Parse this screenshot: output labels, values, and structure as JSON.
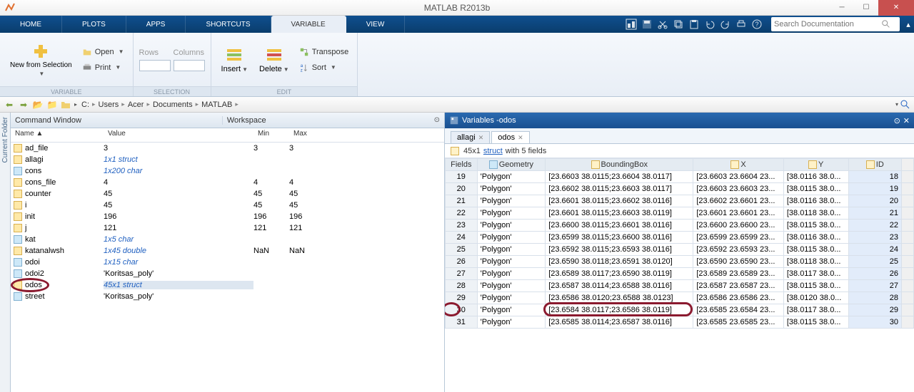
{
  "titlebar": {
    "title": "MATLAB R2013b"
  },
  "tabs": [
    "HOME",
    "PLOTS",
    "APPS",
    "SHORTCUTS",
    "VARIABLE",
    "VIEW"
  ],
  "active_tab": 4,
  "search_placeholder": "Search Documentation",
  "ribbon": {
    "variable": {
      "newfrom": "New from\nSelection",
      "open": "Open",
      "print": "Print",
      "rows": "Rows",
      "columns": "Columns"
    },
    "edit": {
      "insert": "Insert",
      "delete": "Delete",
      "sort": "Sort",
      "transpose": "Transpose"
    },
    "group_labels": [
      "VARIABLE",
      "SELECTION",
      "EDIT"
    ]
  },
  "breadcrumb": [
    "C:",
    "Users",
    "Acer",
    "Documents",
    "MATLAB"
  ],
  "sidebar_label": "Current Folder",
  "panes": {
    "command": "Command Window",
    "workspace": "Workspace",
    "variables_prefix": "Variables - ",
    "variables_name": "odos"
  },
  "ws_headers": [
    "Name ▲",
    "Value",
    "Min",
    "Max"
  ],
  "ws_rows": [
    {
      "icon": "num",
      "name": "ad_file",
      "val": "3",
      "min": "3",
      "max": "3"
    },
    {
      "icon": "num",
      "name": "allagi",
      "val": "1x1 struct",
      "italic": true
    },
    {
      "icon": "abc",
      "name": "cons",
      "val": "1x200 char",
      "italic": true
    },
    {
      "icon": "num",
      "name": "cons_file",
      "val": "4",
      "min": "4",
      "max": "4"
    },
    {
      "icon": "num",
      "name": "counter",
      "val": "45",
      "min": "45",
      "max": "45"
    },
    {
      "icon": "num",
      "name": "i",
      "val": "45",
      "min": "45",
      "max": "45"
    },
    {
      "icon": "num",
      "name": "init",
      "val": "196",
      "min": "196",
      "max": "196"
    },
    {
      "icon": "num",
      "name": "j",
      "val": "121",
      "min": "121",
      "max": "121"
    },
    {
      "icon": "abc",
      "name": "kat",
      "val": "1x5 char",
      "italic": true
    },
    {
      "icon": "num",
      "name": "katanalwsh",
      "val": "1x45 double",
      "italic": true,
      "min": "NaN",
      "max": "NaN"
    },
    {
      "icon": "abc",
      "name": "odoi",
      "val": "1x15 char",
      "italic": true
    },
    {
      "icon": "abc",
      "name": "odoi2",
      "val": "'Koritsas_poly'"
    },
    {
      "icon": "num",
      "name": "odos",
      "val": "45x1 struct",
      "italic": true,
      "selected": true,
      "circled": true
    },
    {
      "icon": "abc",
      "name": "street",
      "val": "'Koritsas_poly'"
    }
  ],
  "var_tabs": [
    {
      "name": "allagi",
      "active": false
    },
    {
      "name": "odos",
      "active": true
    }
  ],
  "var_info": {
    "size": "45x1",
    "type": "struct",
    "suffix": "with 5 fields"
  },
  "var_columns": [
    {
      "key": "Fields",
      "label": "Fields"
    },
    {
      "key": "Geometry",
      "label": "Geometry",
      "icon": "str"
    },
    {
      "key": "BoundingBox",
      "label": "BoundingBox",
      "icon": "num"
    },
    {
      "key": "X",
      "label": "X",
      "icon": "num"
    },
    {
      "key": "Y",
      "label": "Y",
      "icon": "num"
    },
    {
      "key": "ID",
      "label": "ID",
      "icon": "num",
      "blue": true
    }
  ],
  "var_rows": [
    {
      "n": 19,
      "g": "'Polygon'",
      "b": "[23.6603 38.0115;23.6604 38.0117]",
      "x": "[23.6603 23.6604 23...",
      "y": "[38.0116 38.0...",
      "id": 18
    },
    {
      "n": 20,
      "g": "'Polygon'",
      "b": "[23.6602 38.0115;23.6603 38.0117]",
      "x": "[23.6603 23.6603 23...",
      "y": "[38.0115 38.0...",
      "id": 19
    },
    {
      "n": 21,
      "g": "'Polygon'",
      "b": "[23.6601 38.0115;23.6602 38.0116]",
      "x": "[23.6602 23.6601 23...",
      "y": "[38.0116 38.0...",
      "id": 20
    },
    {
      "n": 22,
      "g": "'Polygon'",
      "b": "[23.6601 38.0115;23.6603 38.0119]",
      "x": "[23.6601 23.6601 23...",
      "y": "[38.0118 38.0...",
      "id": 21
    },
    {
      "n": 23,
      "g": "'Polygon'",
      "b": "[23.6600 38.0115;23.6601 38.0116]",
      "x": "[23.6600 23.6600 23...",
      "y": "[38.0115 38.0...",
      "id": 22
    },
    {
      "n": 24,
      "g": "'Polygon'",
      "b": "[23.6599 38.0115;23.6600 38.0116]",
      "x": "[23.6599 23.6599 23...",
      "y": "[38.0116 38.0...",
      "id": 23
    },
    {
      "n": 25,
      "g": "'Polygon'",
      "b": "[23.6592 38.0115;23.6593 38.0116]",
      "x": "[23.6592 23.6593 23...",
      "y": "[38.0115 38.0...",
      "id": 24
    },
    {
      "n": 26,
      "g": "'Polygon'",
      "b": "[23.6590 38.0118;23.6591 38.0120]",
      "x": "[23.6590 23.6590 23...",
      "y": "[38.0118 38.0...",
      "id": 25
    },
    {
      "n": 27,
      "g": "'Polygon'",
      "b": "[23.6589 38.0117;23.6590 38.0119]",
      "x": "[23.6589 23.6589 23...",
      "y": "[38.0117 38.0...",
      "id": 26
    },
    {
      "n": 28,
      "g": "'Polygon'",
      "b": "[23.6587 38.0114;23.6588 38.0116]",
      "x": "[23.6587 23.6587 23...",
      "y": "[38.0115 38.0...",
      "id": 27
    },
    {
      "n": 29,
      "g": "'Polygon'",
      "b": "[23.6586 38.0120;23.6588 38.0123]",
      "x": "[23.6586 23.6586 23...",
      "y": "[38.0120 38.0...",
      "id": 28
    },
    {
      "n": 30,
      "g": "'Polygon'",
      "b": "[23.6584 38.0117;23.6586 38.0119]",
      "x": "[23.6585 23.6584 23...",
      "y": "[38.0117 38.0...",
      "id": 29,
      "circled": true
    },
    {
      "n": 31,
      "g": "'Polygon'",
      "b": "[23.6585 38.0114;23.6587 38.0116]",
      "x": "[23.6585 23.6585 23...",
      "y": "[38.0115 38.0...",
      "id": 30
    }
  ]
}
